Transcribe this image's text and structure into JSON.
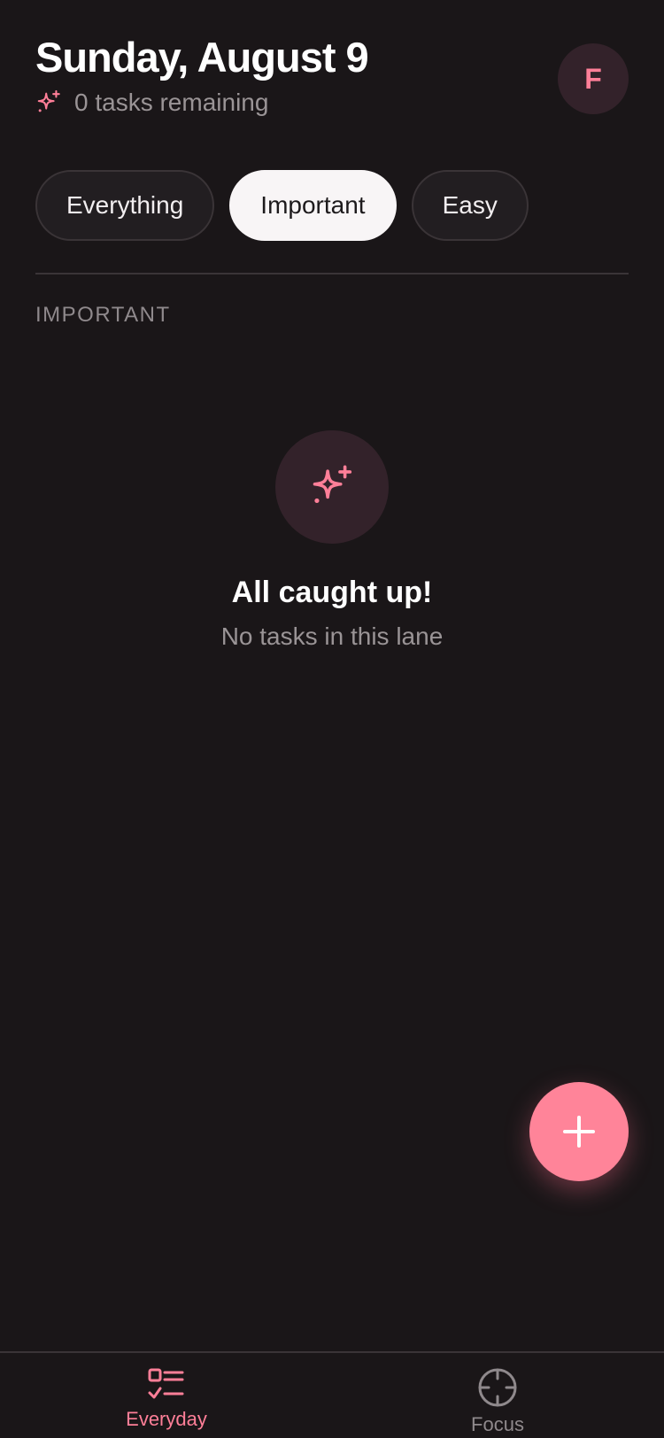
{
  "header": {
    "date_title": "Sunday, August 9",
    "remaining_text": "0 tasks remaining",
    "avatar_initial": "F"
  },
  "filters": {
    "items": [
      {
        "label": "Everything",
        "active": false
      },
      {
        "label": "Important",
        "active": true
      },
      {
        "label": "Easy",
        "active": false
      }
    ]
  },
  "section": {
    "label": "IMPORTANT"
  },
  "empty_state": {
    "title": "All caught up!",
    "subtitle": "No tasks in this lane",
    "icon": "sparkle-icon"
  },
  "fab": {
    "icon": "plus-icon"
  },
  "bottom_nav": {
    "items": [
      {
        "label": "Everyday",
        "icon": "checklist-icon",
        "active": true
      },
      {
        "label": "Focus",
        "icon": "crosshair-icon",
        "active": false
      }
    ]
  },
  "colors": {
    "background": "#1a1618",
    "accent": "#ff7f98",
    "fab": "#ff8499",
    "chip_active_bg": "#f8f5f6",
    "muted_text": "#9a9496"
  }
}
